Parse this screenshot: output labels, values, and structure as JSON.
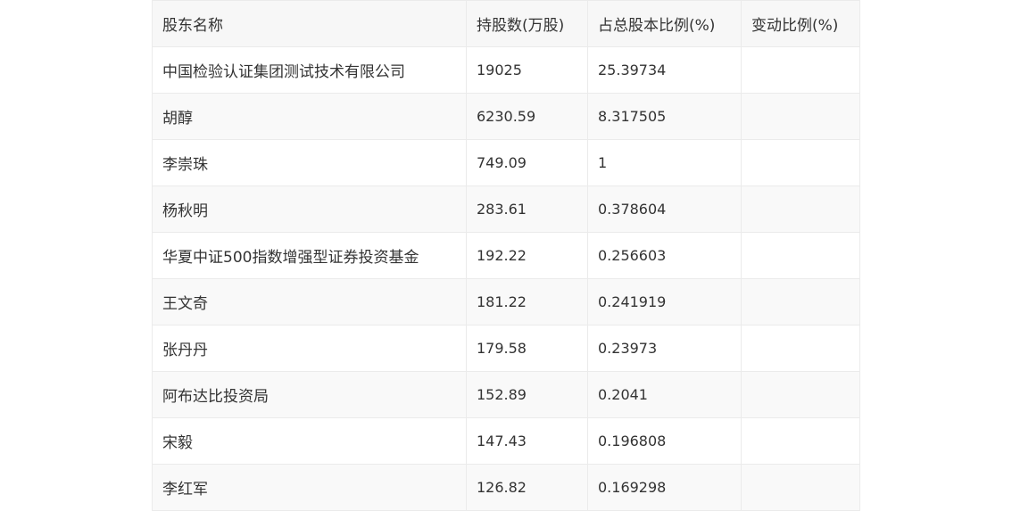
{
  "table": {
    "headers": [
      "股东名称",
      "持股数(万股)",
      "占总股本比例(%)",
      "变动比例(%)"
    ],
    "rows": [
      {
        "name": "中国检验认证集团测试技术有限公司",
        "shares": "19025",
        "ratio": "25.39734",
        "change": ""
      },
      {
        "name": "胡醇",
        "shares": "6230.59",
        "ratio": "8.317505",
        "change": ""
      },
      {
        "name": "李崇珠",
        "shares": "749.09",
        "ratio": "1",
        "change": ""
      },
      {
        "name": "杨秋明",
        "shares": "283.61",
        "ratio": "0.378604",
        "change": ""
      },
      {
        "name": "华夏中证500指数增强型证券投资基金",
        "shares": "192.22",
        "ratio": "0.256603",
        "change": ""
      },
      {
        "name": "王文奇",
        "shares": "181.22",
        "ratio": "0.241919",
        "change": ""
      },
      {
        "name": "张丹丹",
        "shares": "179.58",
        "ratio": "0.23973",
        "change": ""
      },
      {
        "name": "阿布达比投资局",
        "shares": "152.89",
        "ratio": "0.2041",
        "change": ""
      },
      {
        "name": "宋毅",
        "shares": "147.43",
        "ratio": "0.196808",
        "change": ""
      },
      {
        "name": "李红军",
        "shares": "126.82",
        "ratio": "0.169298",
        "change": ""
      }
    ]
  }
}
